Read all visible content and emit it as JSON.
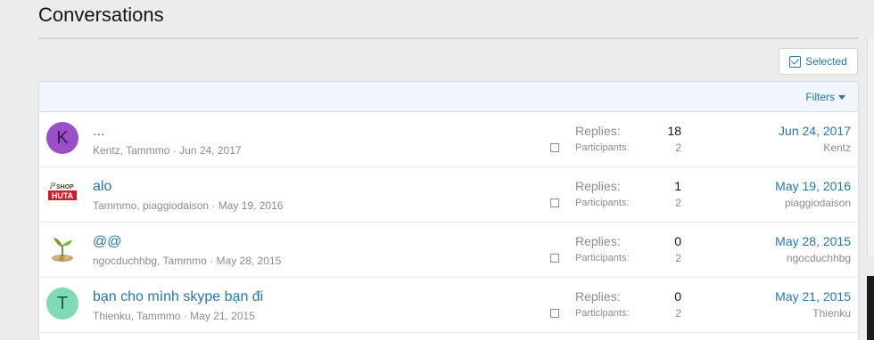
{
  "page": {
    "title": "Conversations"
  },
  "toolbar": {
    "selected_label": "Selected",
    "filters_label": "Filters"
  },
  "labels": {
    "replies": "Replies:",
    "participants": "Participants:"
  },
  "conversations": [
    {
      "title": "...",
      "participants": "Kentz, Tammmo",
      "date": "Jun 24, 2017",
      "replies": "18",
      "participant_count": "2",
      "last_date": "Jun 24, 2017",
      "last_user": "Kentz",
      "avatar_letter": "K"
    },
    {
      "title": "alo",
      "participants": "Tammmo, piaggiodaison",
      "date": "May 19, 2016",
      "replies": "1",
      "participant_count": "2",
      "last_date": "May 19, 2016",
      "last_user": "piaggiodaison",
      "avatar_logo_top": "SHOP",
      "avatar_logo_bottom": "HUTA"
    },
    {
      "title": "@@",
      "participants": "ngocduchhbg, Tammmo",
      "date": "May 28, 2015",
      "replies": "0",
      "participant_count": "2",
      "last_date": "May 28, 2015",
      "last_user": "ngocduchhbg"
    },
    {
      "title": "bạn cho mình skype bạn đi",
      "participants": "Thienku, Tammmo",
      "date": "May 21, 2015",
      "replies": "0",
      "participant_count": "2",
      "last_date": "May 21, 2015",
      "last_user": "Thienku",
      "avatar_letter": "T"
    }
  ],
  "colors": {
    "link": "#2577b1",
    "muted": "#8c8c8c",
    "header_bg": "#f0f6fb"
  }
}
